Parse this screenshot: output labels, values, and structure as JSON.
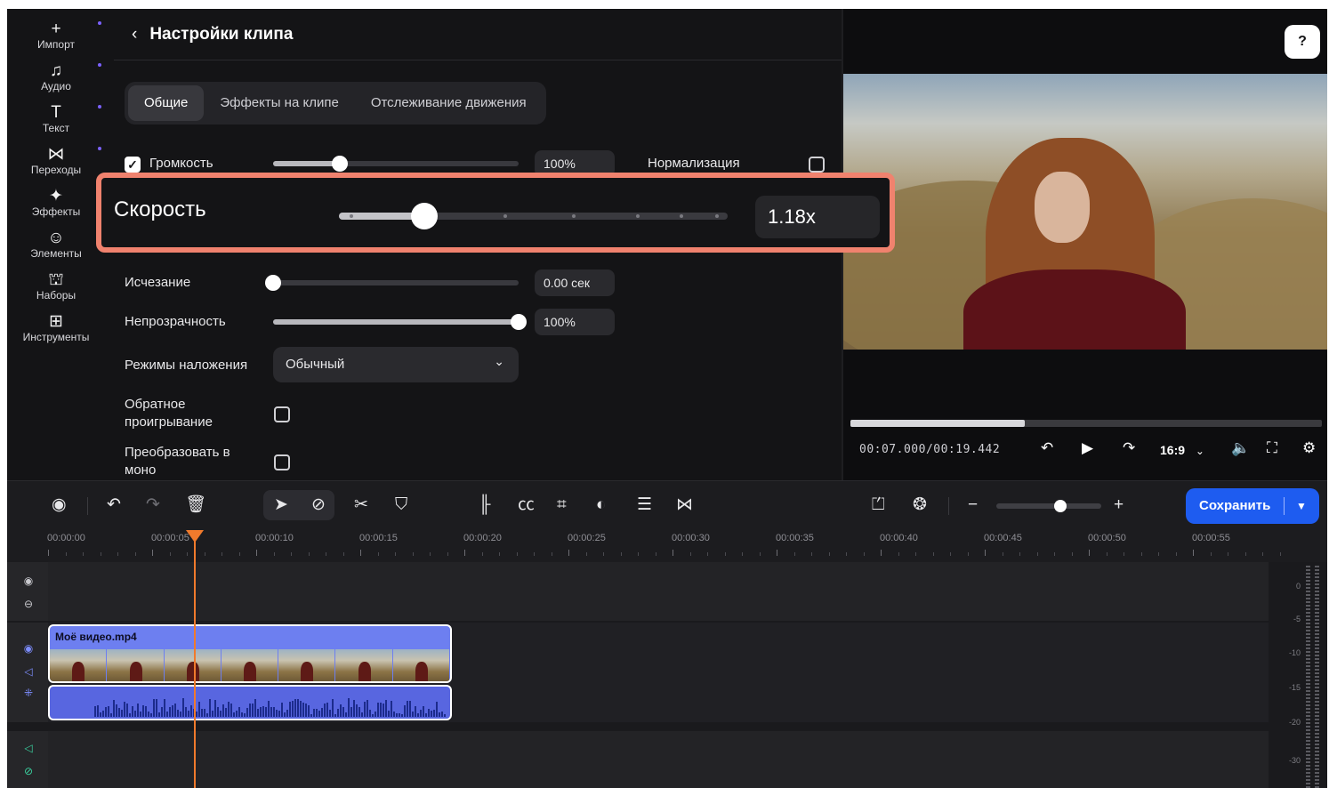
{
  "rail": {
    "items": [
      {
        "label": "Импорт",
        "icon": "plus-icon",
        "glyph": "+"
      },
      {
        "label": "Аудио",
        "icon": "music-icon",
        "glyph": "♫"
      },
      {
        "label": "Текст",
        "icon": "text-icon",
        "glyph": "T"
      },
      {
        "label": "Переходы",
        "icon": "transitions-icon",
        "glyph": "⋈"
      },
      {
        "label": "Эффекты",
        "icon": "effects-icon",
        "glyph": "✦"
      },
      {
        "label": "Элементы",
        "icon": "smiley-icon",
        "glyph": "☺"
      },
      {
        "label": "Наборы",
        "icon": "packs-icon",
        "glyph": "⛫"
      },
      {
        "label": "Инструменты",
        "icon": "tools-icon",
        "glyph": "⊞"
      }
    ]
  },
  "panel": {
    "title": "Настройки клипа",
    "tabs": [
      "Общие",
      "Эффекты на клипе",
      "Отслеживание движения"
    ],
    "active_tab": "Общие",
    "volume": {
      "label": "Громкость",
      "value": "100%",
      "checked": true,
      "level": 0.27
    },
    "normalize": {
      "label": "Нормализация",
      "checked": false
    },
    "speed": {
      "label": "Скорость",
      "value": "1.18x",
      "level": 0.22
    },
    "fade": {
      "label": "Исчезание",
      "value": "0.00 сек",
      "level": 0.0
    },
    "opacity": {
      "label": "Непрозрачность",
      "value": "100%",
      "level": 1.0
    },
    "blend": {
      "label": "Режимы наложения",
      "value": "Обычный"
    },
    "reverse": {
      "label_line1": "Обратное",
      "label_line2": "проигрывание",
      "checked": false
    },
    "mono": {
      "label_line1": "Преобразовать в",
      "label_line2": "моно",
      "checked": false
    }
  },
  "preview": {
    "timecode": "00:07.000/00:19.442",
    "ratio": "16:9",
    "progress": 0.37
  },
  "toolbar": {
    "save_label": "Сохранить",
    "zoom_level": 0.55
  },
  "ruler": {
    "labels": [
      "00:00:00",
      "00:00:05",
      "00:00:10",
      "00:00:15",
      "00:00:20",
      "00:00:25",
      "00:00:30",
      "00:00:35",
      "00:00:40",
      "00:00:45",
      "00:00:50",
      "00:00:55"
    ]
  },
  "timeline": {
    "clip_name": "Моё видео.mp4",
    "meter_labels": [
      "0",
      "-5",
      "-10",
      "-15",
      "-20",
      "-30"
    ]
  },
  "colors": {
    "accent": "#1e5cf0",
    "highlight": "#f0826e",
    "playhead": "#f07a2c",
    "clip": "#6d7ff0"
  }
}
